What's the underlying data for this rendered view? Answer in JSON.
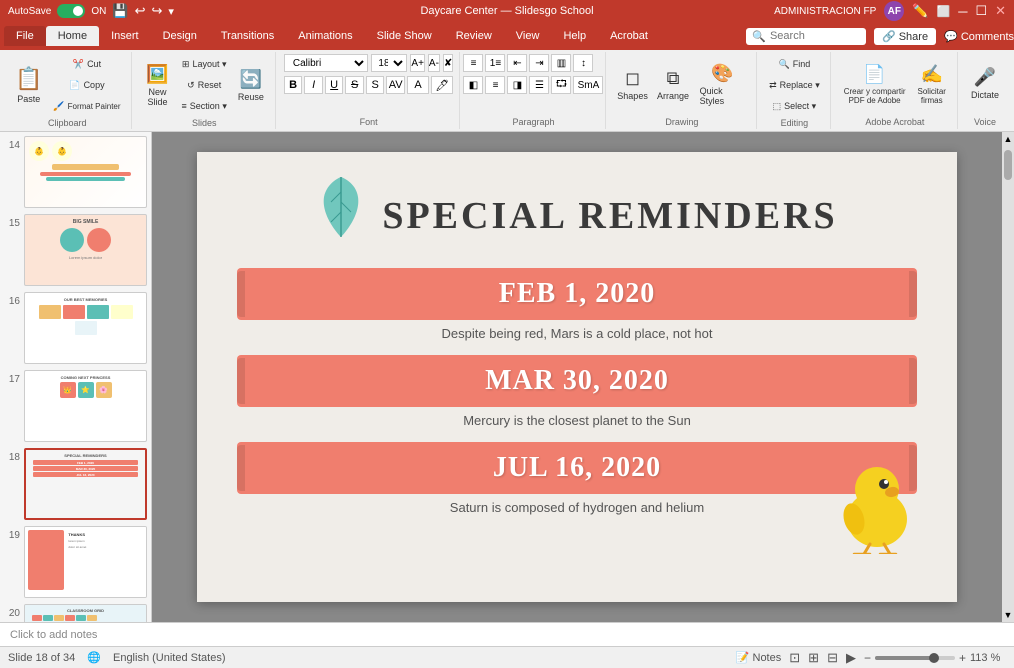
{
  "titlebar": {
    "title": "Daycare Center — Slidesgo School",
    "right_label": "ADMINISTRACION FP",
    "user_initial": "AF"
  },
  "tabs": {
    "items": [
      "File",
      "Home",
      "Insert",
      "Design",
      "Transitions",
      "Animations",
      "Slide Show",
      "Review",
      "View",
      "Help",
      "Acrobat"
    ],
    "active": "Home"
  },
  "autosave": {
    "label": "AutoSave",
    "state": "ON"
  },
  "search": {
    "placeholder": "Search"
  },
  "ribbon": {
    "groups": [
      {
        "name": "Clipboard",
        "label": "Clipboard"
      },
      {
        "name": "Slides",
        "label": "Slides"
      },
      {
        "name": "Font",
        "label": "Font"
      },
      {
        "name": "Paragraph",
        "label": "Paragraph"
      },
      {
        "name": "Drawing",
        "label": "Drawing"
      },
      {
        "name": "Editing",
        "label": "Editing"
      },
      {
        "name": "AdobeAcrobat",
        "label": "Adobe Acrobat"
      },
      {
        "name": "Voice",
        "label": "Voice"
      }
    ],
    "buttons": {
      "paste": "Paste",
      "clipboard": [
        "Cut",
        "Copy",
        "Format Painter"
      ],
      "new_slide": "New\nSlide",
      "layout": "Layout",
      "reset": "Reset",
      "section": "Section",
      "reuse": "Reuse",
      "shapes": "Shapes",
      "arrange": "Arrange",
      "quick_styles": "Quick\nStyles",
      "find": "Find",
      "replace": "Replace",
      "select": "Select",
      "create_share_pdf": "Crear y compartir\nPDF de Adobe",
      "request_signatures": "Solicitar\nfirmas",
      "dictate": "Dictate",
      "share": "Share",
      "comments": "Comments"
    }
  },
  "format_bar": {
    "font": "Calibri",
    "size": "18",
    "bold": "B",
    "italic": "I",
    "underline": "U",
    "strikethrough": "S"
  },
  "slide_panel": {
    "slides": [
      {
        "num": "14",
        "class": "thumb-14"
      },
      {
        "num": "15",
        "class": "thumb-15"
      },
      {
        "num": "16",
        "class": "thumb-16"
      },
      {
        "num": "17",
        "class": "thumb-17"
      },
      {
        "num": "18",
        "class": "thumb-18",
        "active": true
      },
      {
        "num": "19",
        "class": "thumb-19"
      },
      {
        "num": "20",
        "class": "thumb-20"
      }
    ]
  },
  "slide": {
    "title": "SPECIAL REMINDERS",
    "dates": [
      {
        "date": "FEB 1, 2020",
        "desc": "Despite being red, Mars is a cold place, not hot"
      },
      {
        "date": "MAR 30, 2020",
        "desc": "Mercury is the closest planet to the Sun"
      },
      {
        "date": "JUL 16, 2020",
        "desc": "Saturn is composed of hydrogen and helium"
      }
    ]
  },
  "status_bar": {
    "slide_info": "Slide 18 of 34",
    "language": "English (United States)",
    "zoom": "113 %",
    "notes_label": "Notes"
  },
  "bottom_bar": {
    "click_to_add": "Click to add notes"
  }
}
